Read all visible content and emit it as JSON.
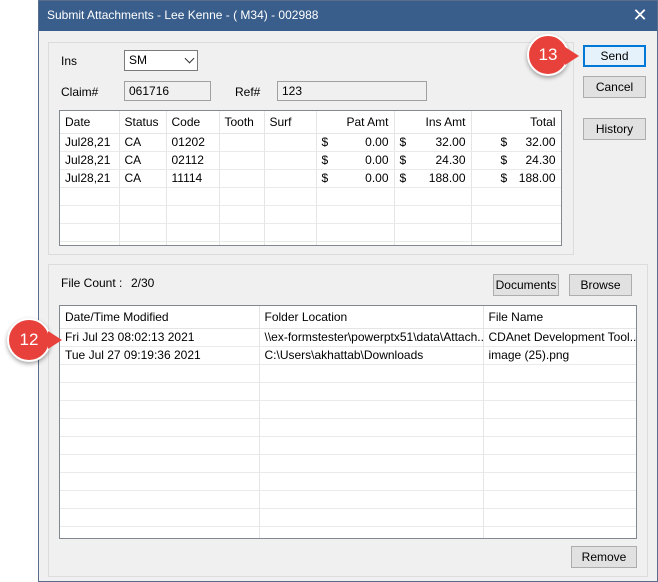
{
  "window": {
    "title": "Submit Attachments - Lee Kenne - ( M34) - 002988",
    "close_glyph": "✕"
  },
  "claim": {
    "ins_label": "Ins",
    "ins_value": "SM",
    "claim_label": "Claim#",
    "claim_value": "061716",
    "ref_label": "Ref#",
    "ref_value": "123"
  },
  "buttons": {
    "send": "Send",
    "cancel": "Cancel",
    "history": "History",
    "documents": "Documents",
    "browse": "Browse",
    "remove": "Remove"
  },
  "procedures": {
    "columns": [
      "Date",
      "Status",
      "Code",
      "Tooth",
      "Surf",
      "Pat Amt",
      "Ins Amt",
      "Total"
    ],
    "rows": [
      [
        "Jul28,21",
        "CA",
        "01202",
        "",
        "",
        "0.00",
        "32.00",
        "32.00"
      ],
      [
        "Jul28,21",
        "CA",
        "02112",
        "",
        "",
        "0.00",
        "24.30",
        "24.30"
      ],
      [
        "Jul28,21",
        "CA",
        "11114",
        "",
        "",
        "0.00",
        "188.00",
        "188.00"
      ]
    ],
    "currency": "$"
  },
  "files": {
    "count_label": "File Count :",
    "count_value": "2/30",
    "columns": [
      "Date/Time Modified",
      "Folder Location",
      "File Name"
    ],
    "rows": [
      [
        "Fri Jul 23 08:02:13 2021",
        "\\\\ex-formstester\\powerptx51\\data\\Attach...",
        "CDAnet Development Tool..."
      ],
      [
        "Tue Jul 27 09:19:36 2021",
        "C:\\Users\\akhattab\\Downloads",
        "image (25).png"
      ]
    ]
  },
  "callouts": {
    "send_step": "13",
    "file_step": "12"
  },
  "colors": {
    "titlebar": "#3a5e8c",
    "callout": "#e8403a",
    "default_button_border": "#0078d7"
  }
}
